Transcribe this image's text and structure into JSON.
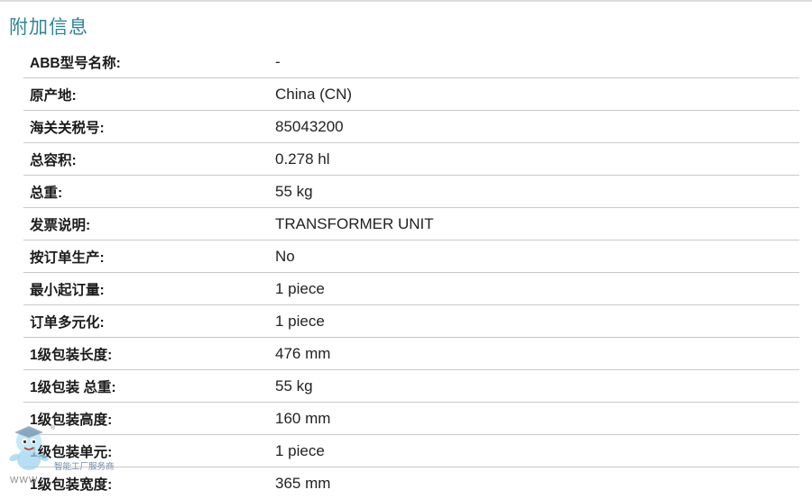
{
  "section": {
    "title": "附加信息"
  },
  "rows": [
    {
      "label": "ABB型号名称:",
      "value": "-"
    },
    {
      "label": "原产地:",
      "value": "China (CN)"
    },
    {
      "label": "海关关税号:",
      "value": "85043200"
    },
    {
      "label": "总容积:",
      "value": "0.278 hl"
    },
    {
      "label": "总重:",
      "value": "55 kg"
    },
    {
      "label": "发票说明:",
      "value": "TRANSFORMER UNIT"
    },
    {
      "label": "按订单生产:",
      "value": "No"
    },
    {
      "label": "最小起订量:",
      "value": "1 piece"
    },
    {
      "label": "订单多元化:",
      "value": "1 piece"
    },
    {
      "label": "1级包装长度:",
      "value": "476 mm"
    },
    {
      "label": "1级包装 总重:",
      "value": "55 kg"
    },
    {
      "label": "1级包装高度:",
      "value": "160 mm"
    },
    {
      "label": "1级包装单元:",
      "value": "1 piece"
    },
    {
      "label": "1级包装宽度:",
      "value": "365 mm"
    }
  ],
  "watermark": {
    "text": "智能工厂服务商",
    "www": "WWW",
    "registered": "®"
  },
  "colors": {
    "title": "#2f8595",
    "divider": "#c9c9c9"
  }
}
